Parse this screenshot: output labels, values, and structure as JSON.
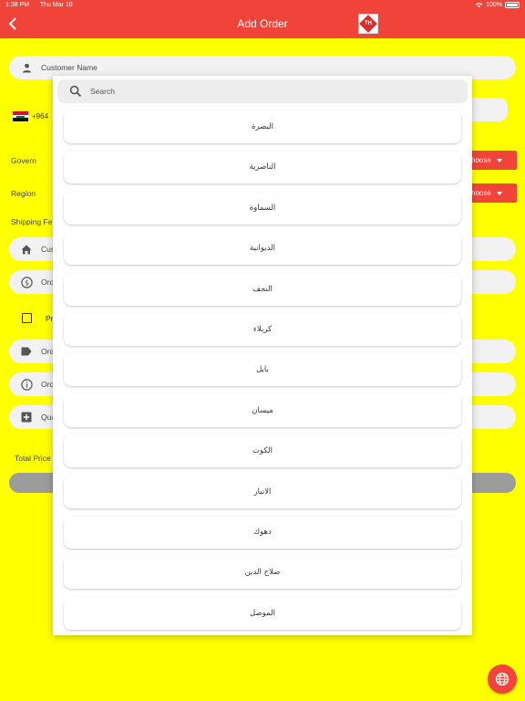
{
  "status": {
    "time": "1:38 PM",
    "date": "Thu Mar 10",
    "battery": "100%"
  },
  "header": {
    "title": "Add Order"
  },
  "form": {
    "customer_name": "Customer Name",
    "phone_code": "+964",
    "govern_label": "Govern",
    "region_label": "Region",
    "shipping_label": "Shipping Fe",
    "choose_label": "hoose",
    "address": "Cus",
    "order_price": "Ord",
    "product_label": "Pr",
    "order_type": "Ord",
    "order_notes": "Ord",
    "quantity": "Qua",
    "total_label": "Total Price"
  },
  "dropdown": {
    "search_placeholder": "Search",
    "options": [
      "البصرة",
      "الناصرية",
      "السماوة",
      "الديوانية",
      "النجف",
      "كربلاء",
      "بابل",
      "ميسان",
      "الكوت",
      "الانبار",
      "دهوك",
      "صلاح الدين",
      "الموصل"
    ]
  },
  "colors": {
    "accent": "#f0443a",
    "background": "#ffff00",
    "field": "#f2f2f2"
  }
}
